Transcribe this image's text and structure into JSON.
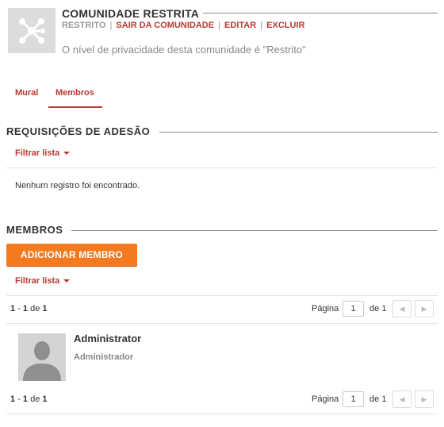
{
  "community": {
    "title": "COMUNIDADE RESTRITA",
    "actions": {
      "privacy": "RESTRITO",
      "leave": "SAIR DA COMUNIDADE",
      "edit": "EDITAR",
      "delete": "EXCLUIR",
      "separator": "|"
    },
    "description": "O nível de privacidade desta comunidade é \"Restrito\""
  },
  "tabs": [
    {
      "label": "Mural"
    },
    {
      "label": "Membros"
    }
  ],
  "requests": {
    "title": "REQUISIÇÕES DE ADESÃO",
    "filter_label": "Filtrar lista",
    "empty_message": "Nenhum registro foi encontrado."
  },
  "members": {
    "title": "MEMBROS",
    "add_button": "ADICIONAR MEMBRO",
    "filter_label": "Filtrar lista",
    "pagination": {
      "range_start": "1",
      "range_dash": "-",
      "range_end": "1",
      "of_word": "de",
      "total": "1",
      "page_label": "Página",
      "page_value": "1",
      "of_pages_word": "de",
      "pages_total": "1"
    },
    "list": [
      {
        "name": "Administrator",
        "role": "Administrador"
      }
    ]
  },
  "colors": {
    "accent": "#b93a32",
    "button": "#f47a20"
  }
}
